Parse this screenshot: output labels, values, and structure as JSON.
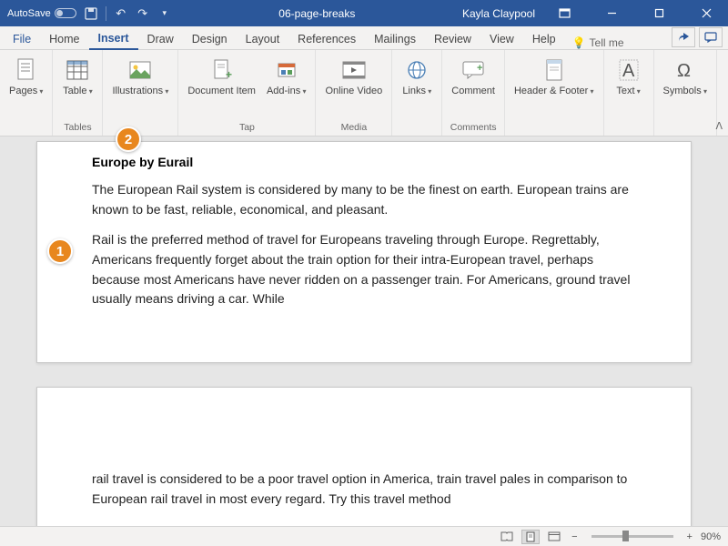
{
  "titlebar": {
    "autosave": "AutoSave",
    "autosave_state": "Off",
    "doc_title": "06-page-breaks",
    "user": "Kayla Claypool"
  },
  "tabs": {
    "file": "File",
    "home": "Home",
    "insert": "Insert",
    "draw": "Draw",
    "design": "Design",
    "layout": "Layout",
    "references": "References",
    "mailings": "Mailings",
    "review": "Review",
    "view": "View",
    "help": "Help",
    "tellme": "Tell me"
  },
  "ribbon": {
    "pages": "Pages",
    "table": "Table",
    "tables_group": "Tables",
    "illustrations": "Illustrations",
    "document_item": "Document Item",
    "addins": "Add-ins",
    "tap_group": "Tap",
    "online_video": "Online Video",
    "media_group": "Media",
    "links": "Links",
    "comment": "Comment",
    "comments_group": "Comments",
    "header_footer": "Header & Footer",
    "text": "Text",
    "symbols": "Symbols"
  },
  "document": {
    "title": "Europe by Eurail",
    "p1": "The European Rail system is considered by many to be the finest on earth. European trains are known to be fast, reliable, economical, and pleasant.",
    "p2": "Rail is the preferred method of travel for Europeans traveling through Europe. Regrettably, Americans frequently forget about the train option for their intra-European travel, perhaps because most Americans have never ridden on a passenger train. For Americans, ground travel usually means driving a car. While",
    "p3": "rail travel is considered to be a poor travel option in America, train travel pales in comparison to European rail travel in most every regard. Try this travel method"
  },
  "callouts": {
    "c1": "1",
    "c2": "2"
  },
  "status": {
    "zoom": "90%",
    "minus": "−",
    "plus": "+"
  }
}
